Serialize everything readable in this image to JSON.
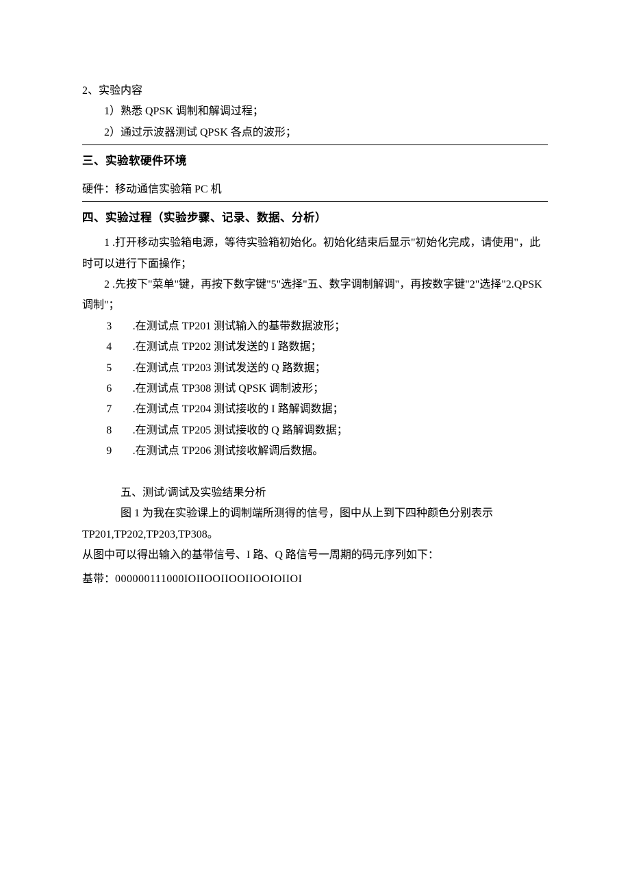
{
  "sec2_heading": "2、实验内容",
  "sec2_item1": "1）熟悉 QPSK 调制和解调过程；",
  "sec2_item2": "2）通过示波器测试 QPSK 各点的波形；",
  "sec3_title": "三、实验软硬件环境",
  "sec3_hardware": "硬件：移动通信实验箱 PC 机",
  "sec4_title": "四、实验过程（实验步骤、记录、数据、分析）",
  "step1": "1   .打开移动实验箱电源，等待实验箱初始化。初始化结束后显示\"初始化完成，请使用\"，此时可以进行下面操作；",
  "step2": "2   .先按下\"菜单\"键，再按下数字键\"5\"选择\"五、数字调制解调\"，再按数字键\"2\"选择\"2.QPSK 调制\"；",
  "steps": [
    {
      "n": "3",
      "t": ".在测试点 TP201 测试输入的基带数据波形；"
    },
    {
      "n": "4",
      "t": ".在测试点 TP202 测试发送的 I 路数据；"
    },
    {
      "n": "5",
      "t": ".在测试点 TP203 测试发送的 Q 路数据；"
    },
    {
      "n": "6",
      "t": ".在测试点 TP308 测试 QPSK 调制波形；"
    },
    {
      "n": "7",
      "t": ".在测试点 TP204 测试接收的 I 路解调数据；"
    },
    {
      "n": "8",
      "t": ".在测试点 TP205 测试接收的 Q 路解调数据；"
    },
    {
      "n": "9",
      "t": ".在测试点 TP206 测试接收解调后数据。"
    }
  ],
  "sec5_title": "五、测试/调试及实验结果分析",
  "fig_caption_a": "图 1 为我在实验课上的调制端所测得的信号，图中从上到下四种颜色分别表示",
  "fig_caption_b": "TP201,TP202,TP203,TP308。",
  "conclusion_line": "从图中可以得出输入的基带信号、I 路、Q 路信号一周期的码元序列如下：",
  "baseband_label": "基带：",
  "baseband_digits": "000000111000",
  "baseband_tail": "IOIIOOIIOOIIOOIOIIOI"
}
